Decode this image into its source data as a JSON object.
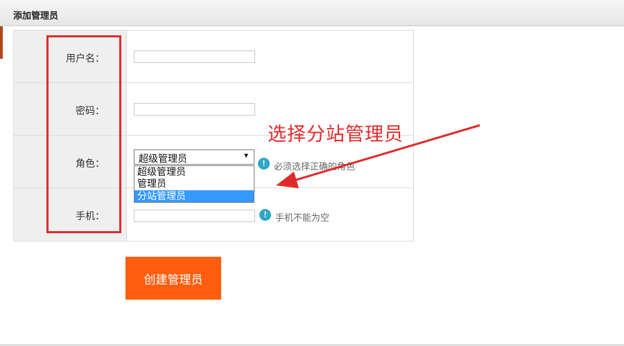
{
  "dialog": {
    "title": "添加管理员"
  },
  "form": {
    "username": {
      "label": "用户名：",
      "value": ""
    },
    "password": {
      "label": "密码：",
      "value": ""
    },
    "role": {
      "label": "角色：",
      "selected": "超级管理员",
      "options": [
        "超级管理员",
        "管理员",
        "分站管理员"
      ],
      "highlighted_option": "分站管理员",
      "hint": "必须选择正确的角色"
    },
    "phone": {
      "label": "手机：",
      "value": "",
      "hint": "手机不能为空"
    }
  },
  "annotation": {
    "text": "选择分站管理员",
    "color": "#e02a2a"
  },
  "submit": {
    "label": "创建管理员",
    "color": "#ff5e0e"
  },
  "icons": {
    "hint": "info-exclamation-icon"
  }
}
